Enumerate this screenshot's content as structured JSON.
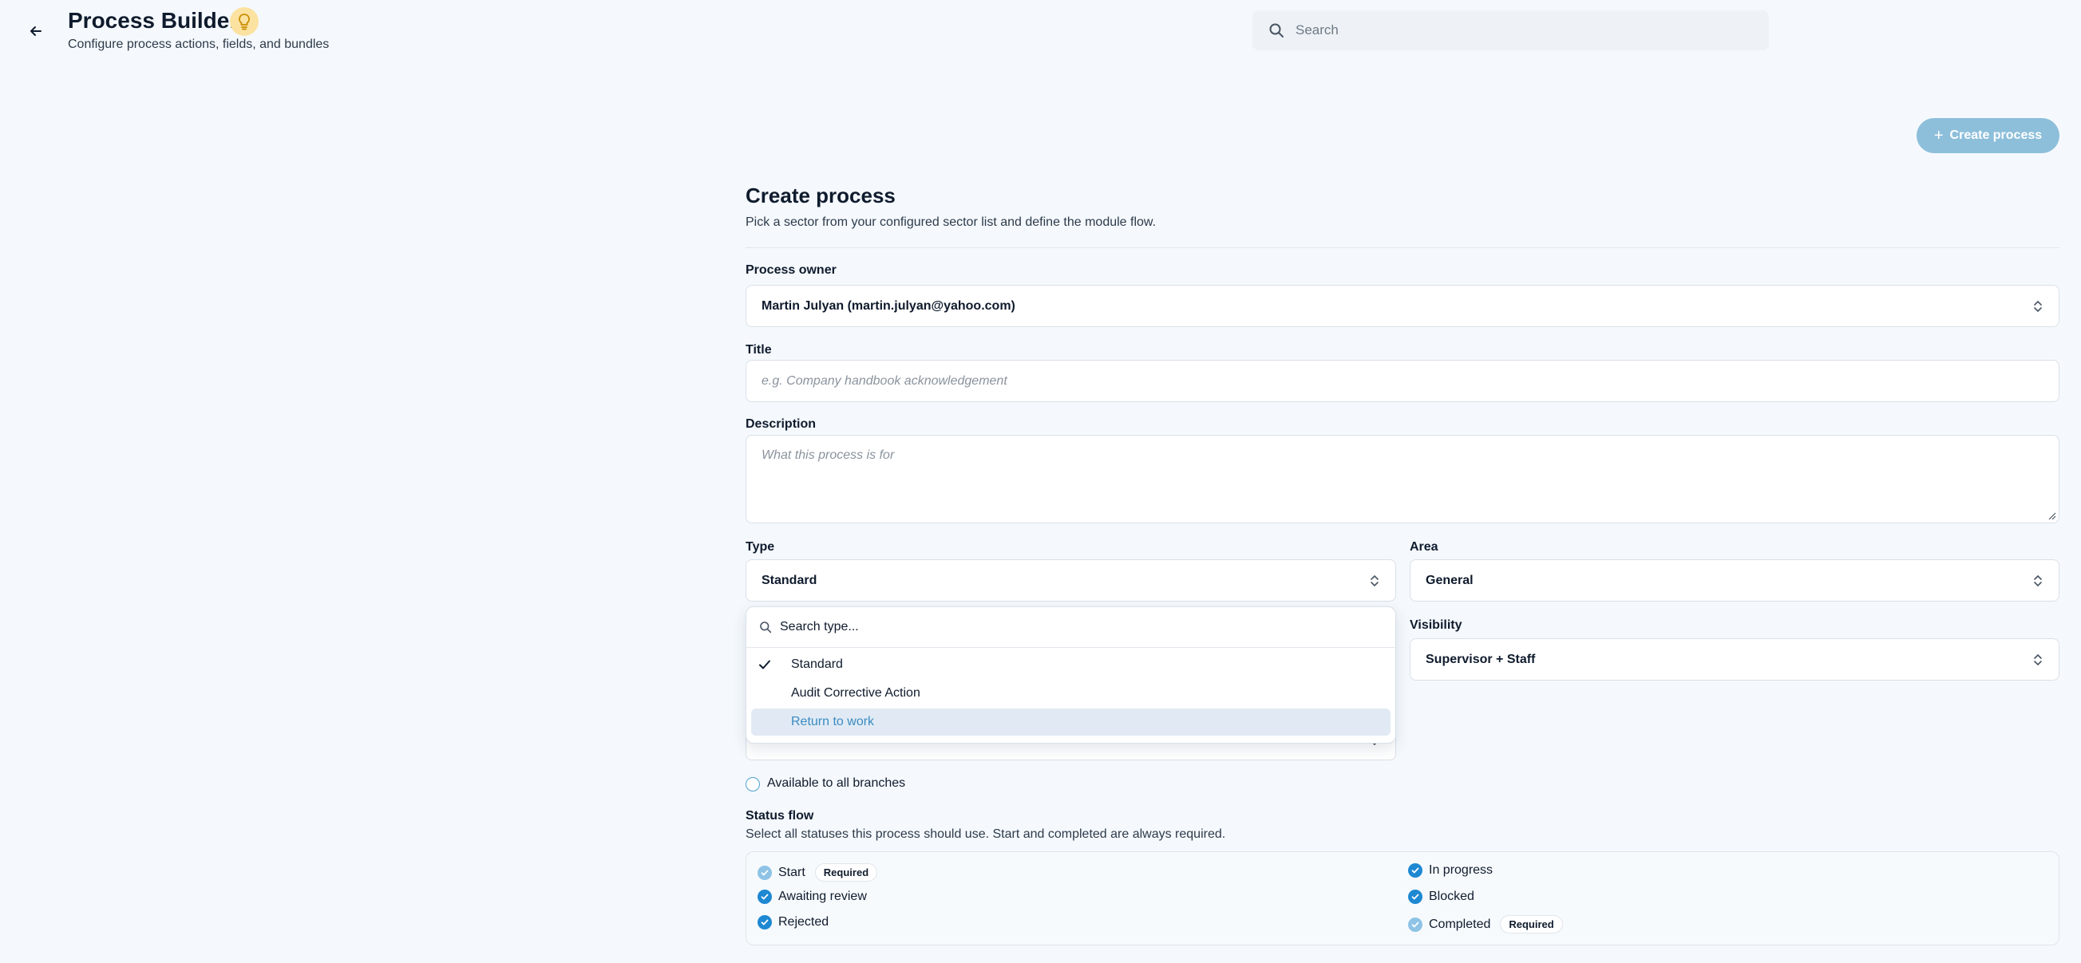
{
  "header": {
    "title": "Process Builder",
    "subtitle": "Configure process actions, fields, and bundles",
    "search_placeholder": "Search",
    "create_button": "Create process"
  },
  "form": {
    "title": "Create process",
    "description": "Pick a sector from your configured sector list and define the module flow.",
    "owner": {
      "label": "Process owner",
      "value": "Martin Julyan (martin.julyan@yahoo.com)"
    },
    "title_field": {
      "label": "Title",
      "placeholder": "e.g. Company handbook acknowledgement"
    },
    "description_field": {
      "label": "Description",
      "placeholder": "What this process is for"
    },
    "type": {
      "label": "Type",
      "value": "Standard",
      "search_placeholder": "Search type...",
      "options": [
        "Standard",
        "Audit Corrective Action",
        "Return to work"
      ],
      "selected": "Standard",
      "highlighted": "Return to work"
    },
    "area": {
      "label": "Area",
      "value": "General"
    },
    "visibility": {
      "label": "Visibility",
      "value": "Supervisor + Staff"
    },
    "branches": {
      "label": "Available to all branches",
      "checked": false
    }
  },
  "status_flow": {
    "title": "Status flow",
    "description": "Select all statuses this process should use. Start and completed are always required.",
    "required_badge": "Required",
    "items": [
      {
        "label": "Start",
        "required": true,
        "checked": true
      },
      {
        "label": "Awaiting review",
        "required": false,
        "checked": true
      },
      {
        "label": "Rejected",
        "required": false,
        "checked": true
      },
      {
        "label": "In progress",
        "required": false,
        "checked": true
      },
      {
        "label": "Blocked",
        "required": false,
        "checked": true
      },
      {
        "label": "Completed",
        "required": true,
        "checked": true
      }
    ]
  },
  "colors": {
    "accent": "#1e88d2",
    "create_button_bg": "#8dbfdb",
    "highlight_bg": "#e1eaf4",
    "background": "#f5f9fd"
  }
}
